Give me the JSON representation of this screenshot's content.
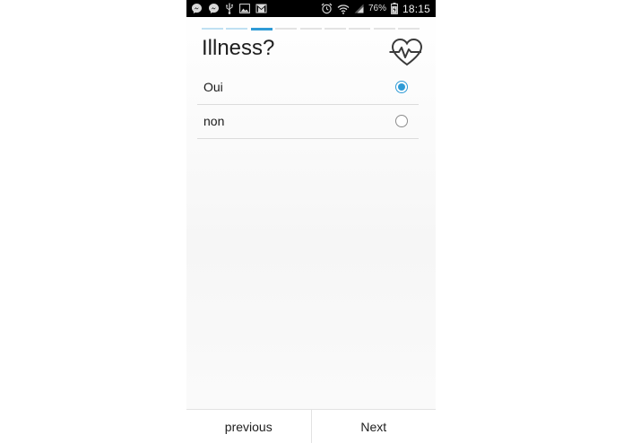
{
  "status_bar": {
    "left_icons": [
      "messenger-icon",
      "messenger-icon",
      "usb-icon",
      "gallery-icon",
      "gmail-icon"
    ],
    "right_icons": [
      "alarm-icon",
      "wifi-icon",
      "signal-icon",
      "battery-charging-icon"
    ],
    "battery_percent": "76%",
    "clock": "18:15"
  },
  "progress": {
    "total_steps": 9,
    "current_step": 3,
    "done_color": "#bfe0f2",
    "current_color": "#2f9bd6",
    "todo_color": "#e3e3e3"
  },
  "question": {
    "title": "Illness?",
    "icon": "heart-pulse-icon"
  },
  "options": [
    {
      "label": "Oui",
      "selected": true
    },
    {
      "label": "non",
      "selected": false
    }
  ],
  "navigation": {
    "previous_label": "previous",
    "next_label": "Next"
  },
  "colors": {
    "accent": "#2f9bd6",
    "status_bar": "#000000"
  }
}
